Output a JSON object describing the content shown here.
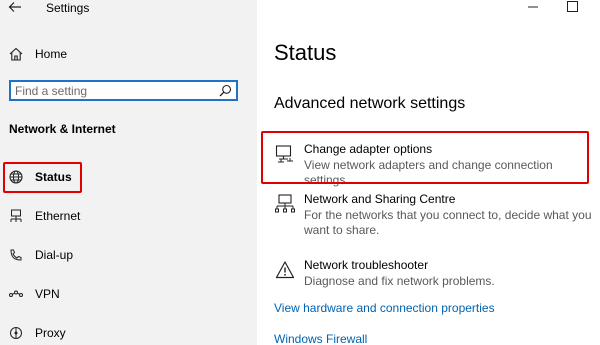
{
  "app": {
    "title": "Settings"
  },
  "sidebar": {
    "home_label": "Home",
    "search": {
      "placeholder": "Find a setting",
      "value": ""
    },
    "section_heading": "Network & Internet",
    "items": [
      {
        "label": "Status",
        "icon": "globe-icon",
        "selected": true
      },
      {
        "label": "Ethernet",
        "icon": "ethernet-icon"
      },
      {
        "label": "Dial-up",
        "icon": "dial-up-icon"
      },
      {
        "label": "VPN",
        "icon": "vpn-icon"
      },
      {
        "label": "Proxy",
        "icon": "proxy-icon"
      }
    ]
  },
  "main": {
    "page_title": "Status",
    "sub_heading": "Advanced network settings",
    "settings": [
      {
        "title": "Change adapter options",
        "description": "View network adapters and change connection settings.",
        "icon": "network-adapter-icon"
      },
      {
        "title": "Network and Sharing Centre",
        "description": "For the networks that you connect to, decide what you want to share.",
        "icon": "sharing-centre-icon"
      },
      {
        "title": "Network troubleshooter",
        "description": "Diagnose and fix network problems.",
        "icon": "warning-icon"
      }
    ],
    "links": [
      "View hardware and connection properties",
      "Windows Firewall"
    ]
  },
  "colors": {
    "sidebar_bg": "#f2f2f2",
    "accent": "#0063b1",
    "search_border": "#1e73c6",
    "highlight": "#e00000"
  }
}
